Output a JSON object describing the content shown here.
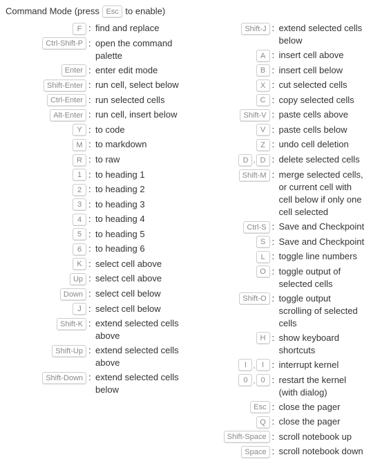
{
  "header": {
    "prefix": "Command Mode (press ",
    "key": "Esc",
    "suffix": " to enable)"
  },
  "left": [
    {
      "keys": [
        "F"
      ],
      "desc": "find and replace"
    },
    {
      "keys": [
        "Ctrl-Shift-P"
      ],
      "desc": "open the command palette"
    },
    {
      "keys": [
        "Enter"
      ],
      "desc": "enter edit mode"
    },
    {
      "keys": [
        "Shift-Enter"
      ],
      "desc": "run cell, select below"
    },
    {
      "keys": [
        "Ctrl-Enter"
      ],
      "desc": "run selected cells"
    },
    {
      "keys": [
        "Alt-Enter"
      ],
      "desc": "run cell, insert below"
    },
    {
      "keys": [
        "Y"
      ],
      "desc": "to code"
    },
    {
      "keys": [
        "M"
      ],
      "desc": "to markdown"
    },
    {
      "keys": [
        "R"
      ],
      "desc": "to raw"
    },
    {
      "keys": [
        "1"
      ],
      "desc": "to heading 1"
    },
    {
      "keys": [
        "2"
      ],
      "desc": "to heading 2"
    },
    {
      "keys": [
        "3"
      ],
      "desc": "to heading 3"
    },
    {
      "keys": [
        "4"
      ],
      "desc": "to heading 4"
    },
    {
      "keys": [
        "5"
      ],
      "desc": "to heading 5"
    },
    {
      "keys": [
        "6"
      ],
      "desc": "to heading 6"
    },
    {
      "keys": [
        "K"
      ],
      "desc": "select cell above"
    },
    {
      "keys": [
        "Up"
      ],
      "desc": "select cell above"
    },
    {
      "keys": [
        "Down"
      ],
      "desc": "select cell below"
    },
    {
      "keys": [
        "J"
      ],
      "desc": "select cell below"
    },
    {
      "keys": [
        "Shift-K"
      ],
      "desc": "extend selected cells above"
    },
    {
      "keys": [
        "Shift-Up"
      ],
      "desc": "extend selected cells above"
    },
    {
      "keys": [
        "Shift-Down"
      ],
      "desc": "extend selected cells below"
    }
  ],
  "right": [
    {
      "keys": [
        "Shift-J"
      ],
      "desc": "extend selected cells below"
    },
    {
      "keys": [
        "A"
      ],
      "desc": "insert cell above"
    },
    {
      "keys": [
        "B"
      ],
      "desc": "insert cell below"
    },
    {
      "keys": [
        "X"
      ],
      "desc": "cut selected cells"
    },
    {
      "keys": [
        "C"
      ],
      "desc": "copy selected cells"
    },
    {
      "keys": [
        "Shift-V"
      ],
      "desc": "paste cells above"
    },
    {
      "keys": [
        "V"
      ],
      "desc": "paste cells below"
    },
    {
      "keys": [
        "Z"
      ],
      "desc": "undo cell deletion"
    },
    {
      "keys": [
        "D",
        "D"
      ],
      "desc": "delete selected cells"
    },
    {
      "keys": [
        "Shift-M"
      ],
      "desc": "merge selected cells, or current cell with cell below if only one cell selected"
    },
    {
      "keys": [
        "Ctrl-S"
      ],
      "desc": "Save and Checkpoint"
    },
    {
      "keys": [
        "S"
      ],
      "desc": "Save and Checkpoint"
    },
    {
      "keys": [
        "L"
      ],
      "desc": "toggle line numbers"
    },
    {
      "keys": [
        "O"
      ],
      "desc": "toggle output of selected cells"
    },
    {
      "keys": [
        "Shift-O"
      ],
      "desc": "toggle output scrolling of selected cells"
    },
    {
      "keys": [
        "H"
      ],
      "desc": "show keyboard shortcuts"
    },
    {
      "keys": [
        "I",
        "I"
      ],
      "desc": "interrupt kernel"
    },
    {
      "keys": [
        "0",
        "0"
      ],
      "desc": "restart the kernel (with dialog)"
    },
    {
      "keys": [
        "Esc"
      ],
      "desc": "close the pager"
    },
    {
      "keys": [
        "Q"
      ],
      "desc": "close the pager"
    },
    {
      "keys": [
        "Shift-Space"
      ],
      "desc": "scroll notebook up"
    },
    {
      "keys": [
        "Space"
      ],
      "desc": "scroll notebook down"
    }
  ]
}
